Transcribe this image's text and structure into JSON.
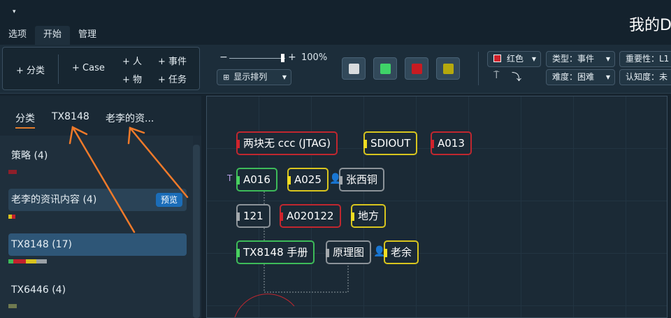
{
  "header": {
    "quick_access_icon": "dropdown-arrow-icon",
    "quick_access_glyph": "▾",
    "app_title": "我的D",
    "menu_tabs": [
      "选项",
      "开始",
      "管理"
    ],
    "active_menu_tab": "开始"
  },
  "ribbon": {
    "add_category": "+ 分类",
    "add_case": "+ Case",
    "add_person": "+ 人",
    "add_object": "+ 物",
    "add_event": "+ 事件",
    "add_task": "+ 任务",
    "zoom_minus": "−",
    "zoom_plus": "+",
    "zoom_value": "100%",
    "zoom_level_percent": 100,
    "sort_label": "显示排列",
    "sort_icon": "grid-icon",
    "swatches": [
      {
        "name": "white",
        "color": "#d9dcde"
      },
      {
        "name": "green",
        "color": "#3fd368"
      },
      {
        "name": "red",
        "color": "#c81b22"
      },
      {
        "name": "yellow",
        "color": "#b5a90d"
      }
    ],
    "color_filter": "红色",
    "type_filter": "类型：事件",
    "importance_filter": "重要性：L1",
    "difficulty_filter": "难度：困难",
    "awareness_filter": "认知度：未",
    "pin_icon": "pin-icon",
    "link_icon": "link-arrow-icon"
  },
  "sidebar": {
    "tabs": [
      "分类",
      "TX8148",
      "老李的资..."
    ],
    "active_tab": "分类",
    "preview_label": "预览",
    "categories": [
      {
        "label": "策略 (4)",
        "state": "normal",
        "bar": [
          {
            "color": "#8d1f2a",
            "frac": 1
          }
        ]
      },
      {
        "label": "老李的资讯内容 (4)",
        "state": "hover",
        "bar": [
          {
            "color": "#d9c21d",
            "frac": 0.5
          },
          {
            "color": "#c3212c",
            "frac": 0.5
          }
        ]
      },
      {
        "label": "TX8148 (17)",
        "state": "selected",
        "bar": [
          {
            "color": "#3dbb59",
            "frac": 0.13
          },
          {
            "color": "#c3212c",
            "frac": 0.33
          },
          {
            "color": "#d9c21d",
            "frac": 0.27
          },
          {
            "color": "#9aa1a6",
            "frac": 0.27
          }
        ]
      },
      {
        "label": "TX6446 (4)",
        "state": "normal",
        "bar": [
          {
            "color": "#6f7a50",
            "frac": 1
          }
        ]
      }
    ]
  },
  "canvas": {
    "nodes": [
      {
        "label": "两块无 ccc  (JTAG)",
        "border": "red",
        "tag": "red"
      },
      {
        "label": "SDIOUT",
        "border": "yellow",
        "tag": "yellow"
      },
      {
        "label": "A013",
        "border": "red",
        "tag": "red"
      },
      {
        "label": "A016",
        "border": "green",
        "tag": "green"
      },
      {
        "label": "A025",
        "border": "yellow",
        "tag": "yellow"
      },
      {
        "label": "张西铜",
        "border": "gray",
        "tag": "gray"
      },
      {
        "label": "121",
        "border": "gray",
        "tag": "gray"
      },
      {
        "label": "A020122",
        "border": "red",
        "tag": "red"
      },
      {
        "label": "地方",
        "border": "yellow",
        "tag": "yellow"
      },
      {
        "label": "TX8148 手册",
        "border": "green",
        "tag": "green"
      },
      {
        "label": "原理图",
        "border": "gray",
        "tag": "gray"
      },
      {
        "label": "老余",
        "border": "yellow",
        "tag": "yellow"
      }
    ],
    "task_marker": "T",
    "person_icon": "person-icon",
    "person_glyph": "👤"
  }
}
